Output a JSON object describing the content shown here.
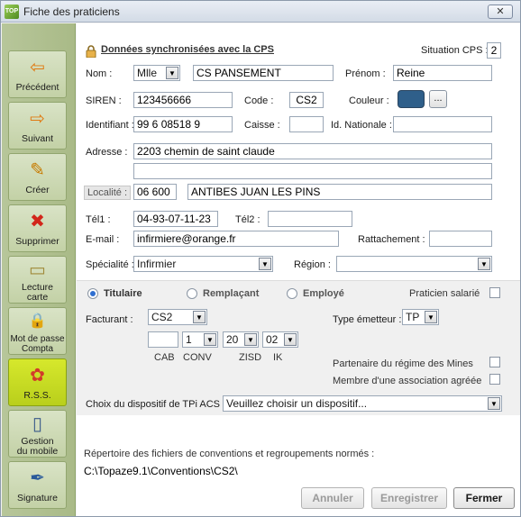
{
  "window": {
    "title": "Fiche des praticiens",
    "app_icon": "topaze-icon",
    "close_symbol": "✕"
  },
  "sidebar": {
    "items": [
      {
        "label": "Précédent",
        "icon": "arrow-left-icon",
        "glyph": "⇦"
      },
      {
        "label": "Suivant",
        "icon": "arrow-right-icon",
        "glyph": "⇨"
      },
      {
        "label": "Créer",
        "icon": "create-icon",
        "glyph": "✎"
      },
      {
        "label": "Supprimer",
        "icon": "delete-icon",
        "glyph": "✖"
      },
      {
        "label_line1": "Lecture",
        "label_line2": "carte",
        "icon": "card-reader-icon",
        "glyph": "▭"
      },
      {
        "label_line1": "Mot de passe",
        "label_line2": "Compta",
        "icon": "password-icon",
        "glyph": "🔒"
      },
      {
        "label": "R.S.S.",
        "icon": "rss-icon",
        "glyph": "✿",
        "active": true
      },
      {
        "label_line1": "Gestion",
        "label_line2": "du mobile",
        "icon": "mobile-icon",
        "glyph": "▯"
      },
      {
        "label": "Signature",
        "icon": "signature-icon",
        "glyph": "✒"
      }
    ]
  },
  "form": {
    "section_title": "Données synchronisées avec la CPS",
    "situation_cps_label": "Situation CPS :",
    "situation_cps_value": "2",
    "nom_label": "Nom :",
    "civilite_value": "Mlle",
    "nom_value": "CS PANSEMENT",
    "prenom_label": "Prénom :",
    "prenom_value": "Reine",
    "siren_label": "SIREN :",
    "siren_value": "123456666",
    "code_label": "Code :",
    "code_value": "CS2",
    "couleur_label": "Couleur :",
    "couleur_color": "#2f5f8a",
    "couleur_button": "...",
    "identifiant_label": "Identifiant :",
    "identifiant_value": "99 6 08518 9",
    "caisse_label": "Caisse :",
    "caisse_value": "",
    "id_nationale_label": "Id. Nationale :",
    "id_nationale_value": "",
    "adresse_label": "Adresse :",
    "adresse_line1": "2203 chemin de saint claude",
    "adresse_line2": "",
    "localite_label": "Localité :",
    "code_postal": "06 600",
    "ville": "ANTIBES JUAN LES PINS",
    "tel1_label": "Tél1 :",
    "tel1_value": "04-93-07-11-23",
    "tel2_label": "Tél2 :",
    "tel2_value": "",
    "email_label": "E-mail :",
    "email_value": "infirmiere@orange.fr",
    "rattachement_label": "Rattachement :",
    "rattachement_value": "",
    "specialite_label": "Spécialité :",
    "specialite_value": "Infirmier",
    "region_label": "Région :",
    "region_value": ""
  },
  "status": {
    "titulaire": "Titulaire",
    "remplacant": "Remplaçant",
    "employe": "Employé",
    "praticien_salarie": "Praticien salarié",
    "selected": "titulaire"
  },
  "facturation": {
    "facturant_label": "Facturant :",
    "facturant_value": "CS2",
    "type_emetteur_label": "Type émetteur :",
    "type_emetteur_value": "TP",
    "cab_value": "",
    "conv_value": "1",
    "zisd_value": "20",
    "ik_value": "02",
    "cab_label": "CAB",
    "conv_label": "CONV",
    "zisd_label": "ZISD",
    "ik_label": "IK",
    "partenaire_label": "Partenaire du régime des Mines",
    "membre_label": "Membre d'une association agréée",
    "dispositif_label": "Choix du dispositif de TPi ACS :",
    "dispositif_value": "Veuillez choisir un dispositif..."
  },
  "footer": {
    "repertoire_label": "Répertoire des fichiers de conventions et regroupements normés :",
    "repertoire_value": "C:\\Topaze9.1\\Conventions\\CS2\\",
    "annuler": "Annuler",
    "enregistrer": "Enregistrer",
    "fermer": "Fermer"
  }
}
